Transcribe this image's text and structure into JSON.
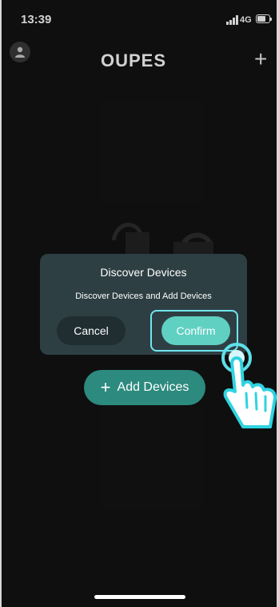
{
  "status": {
    "time": "13:39",
    "network": "4G"
  },
  "header": {
    "logo": "OUPES",
    "avatar_icon": "person-icon",
    "add_icon": "plus-icon",
    "add_label": "+"
  },
  "dialog": {
    "title": "Discover Devices",
    "message": "Discover Devices and Add Devices",
    "cancel_label": "Cancel",
    "confirm_label": "Confirm"
  },
  "main": {
    "add_devices_label": "Add Devices",
    "add_icon_label": "+"
  },
  "colors": {
    "accent": "#5fd0c2",
    "highlight": "#6fe6ef",
    "dialog_bg": "#2e3f44",
    "background": "#131313"
  }
}
